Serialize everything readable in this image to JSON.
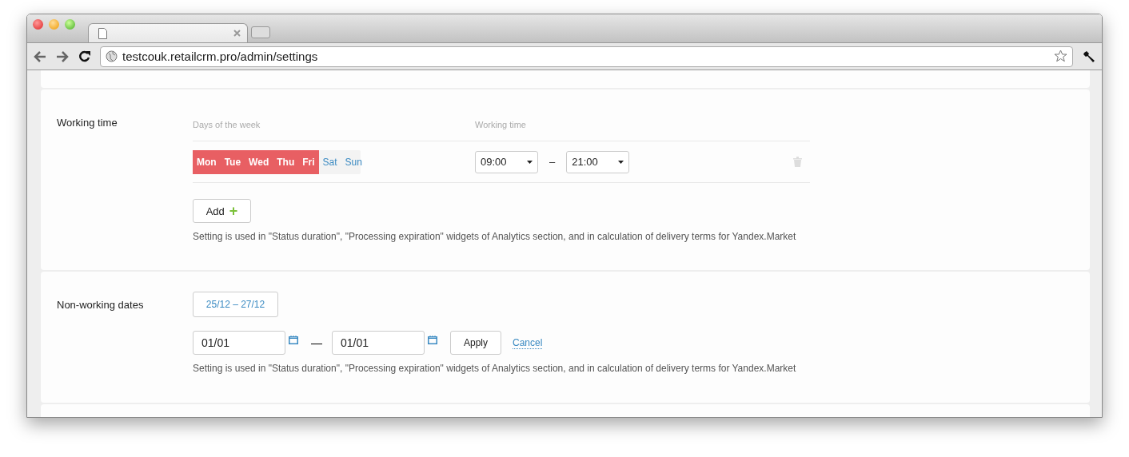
{
  "browser": {
    "url": "testcouk.retailcrm.pro/admin/settings"
  },
  "working_time": {
    "label": "Working time",
    "days_header": "Days of the week",
    "time_header": "Working time",
    "days": [
      {
        "label": "Mon",
        "selected": true
      },
      {
        "label": "Tue",
        "selected": true
      },
      {
        "label": "Wed",
        "selected": true
      },
      {
        "label": "Thu",
        "selected": true
      },
      {
        "label": "Fri",
        "selected": true
      },
      {
        "label": "Sat",
        "selected": false
      },
      {
        "label": "Sun",
        "selected": false
      }
    ],
    "from": "09:00",
    "separator": "–",
    "to": "21:00",
    "add_button": "Add",
    "add_icon": "+",
    "note": "Setting is used in \"Status duration\", \"Processing expiration\" widgets of Analytics section, and in calculation of delivery terms for Yandex.Market"
  },
  "non_working": {
    "label": "Non-working dates",
    "range_tag": "25/12 – 27/12",
    "from": "01/01",
    "separator": "—",
    "to": "01/01",
    "apply": "Apply",
    "cancel": "Cancel",
    "note": "Setting is used in \"Status duration\", \"Processing expiration\" widgets of Analytics section, and in calculation of delivery terms for Yandex.Market"
  }
}
